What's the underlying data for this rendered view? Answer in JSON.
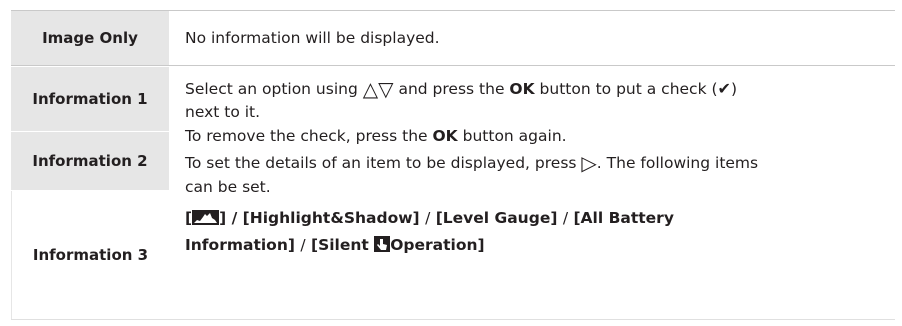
{
  "rows": [
    {
      "label": "Image Only",
      "text": "No information will be displayed."
    },
    {
      "label": "Information 1"
    },
    {
      "label": "Information 2"
    },
    {
      "label": "Information 3"
    }
  ],
  "desc": {
    "p1a": "Select an option using",
    "up_glyph": "△",
    "down_glyph": "▽",
    "p1b": "and press the",
    "ok1": "OK",
    "p1c": "button to put a check (",
    "check_glyph": "✔",
    "p1d": ")",
    "p1e": "next to it.",
    "p2a": "To remove the check, press the",
    "ok2": "OK",
    "p2b": "button again.",
    "p3a": "To set the details of an item to be displayed, press",
    "right_glyph": "▷",
    "p3b": ". The following items",
    "p3c": "can be set.",
    "item_open": "[",
    "item_close": "] /",
    "item2": "[Highlight&Shadow]",
    "sep1": "/",
    "item3": "[Level Gauge]",
    "sep2": "/",
    "item4a": "[All Battery",
    "item4b": "Information]",
    "sep3": "/",
    "item5a": "[Silent",
    "item5b": "Operation]"
  }
}
